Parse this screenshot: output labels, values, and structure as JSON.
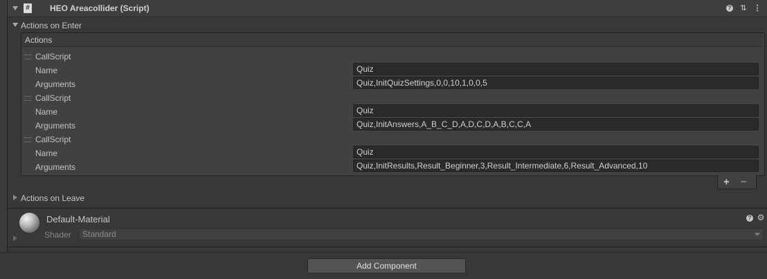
{
  "component": {
    "title": "HEO Areacollider (Script)",
    "script_icon": "#",
    "header_icons": [
      "help-icon",
      "presets-icon",
      "more-icon"
    ]
  },
  "actions_on_enter": {
    "label": "Actions on Enter",
    "list_header": "Actions",
    "items": [
      {
        "type": "CallScript",
        "name_label": "Name",
        "name_value": "Quiz",
        "args_label": "Arguments",
        "args_value": "Quiz,InitQuizSettings,0,0,10,1,0,0,5"
      },
      {
        "type": "CallScript",
        "name_label": "Name",
        "name_value": "Quiz",
        "args_label": "Arguments",
        "args_value": "Quiz,InitAnswers,A_B_C_D,A,D,C,D,A,B,C,C,A"
      },
      {
        "type": "CallScript",
        "name_label": "Name",
        "name_value": "Quiz",
        "args_label": "Arguments",
        "args_value": "Quiz,InitResults,Result_Beginner,3,Result_Intermediate,6,Result_Advanced,10"
      }
    ],
    "add_symbol": "+",
    "remove_symbol": "−"
  },
  "actions_on_leave": {
    "label": "Actions on Leave"
  },
  "material": {
    "name": "Default-Material",
    "shader_label": "Shader",
    "shader_value": "Standard"
  },
  "add_component": {
    "label": "Add Component"
  },
  "colors": {
    "background": "#383838",
    "field": "#2a2a2a",
    "button": "#545454"
  }
}
